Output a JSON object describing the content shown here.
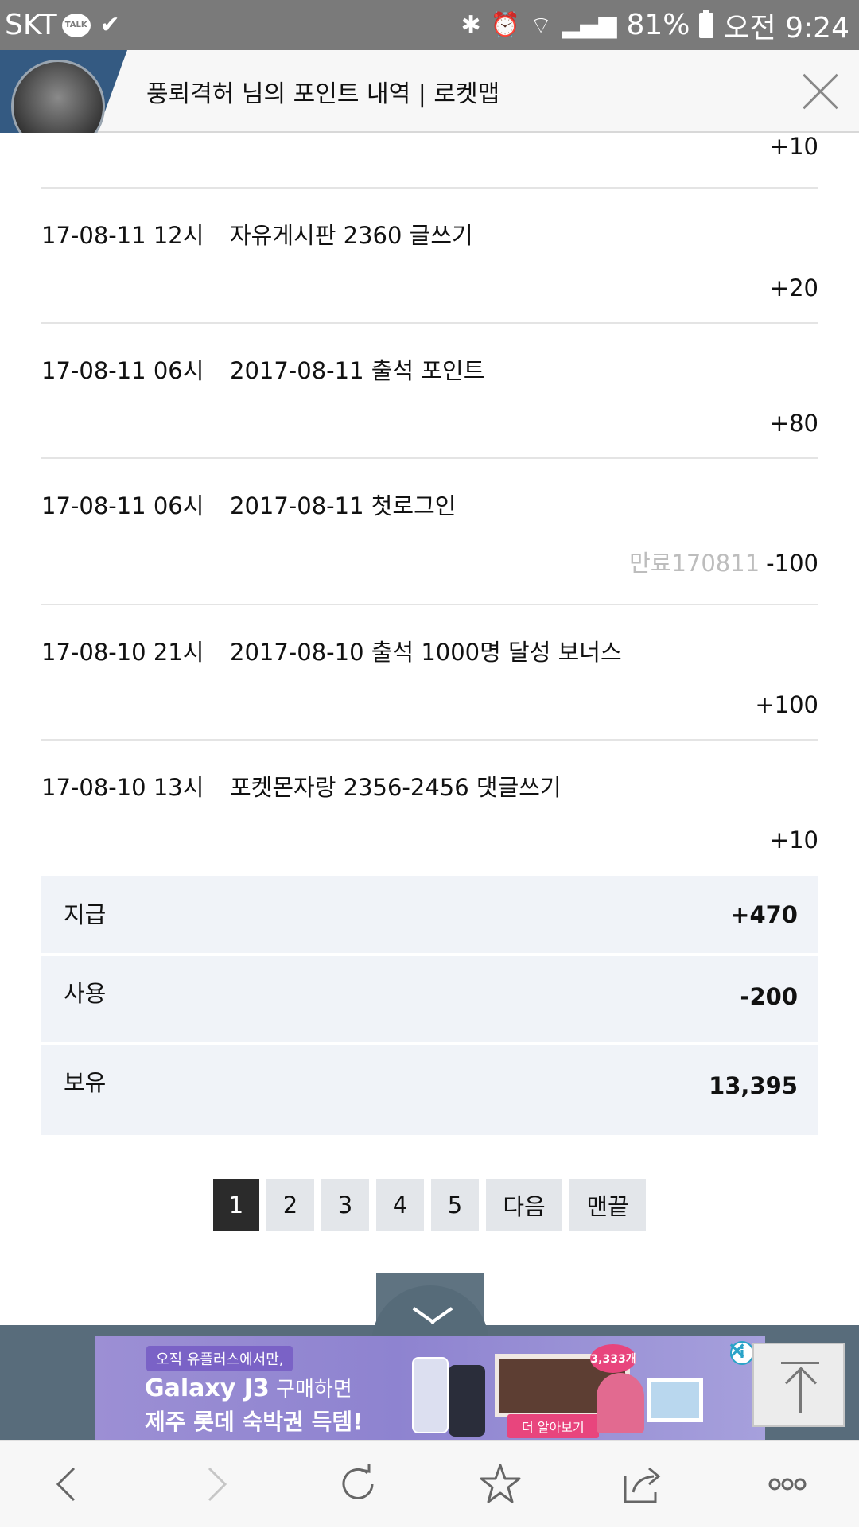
{
  "status_bar": {
    "carrier": "SKT",
    "talk_badge": "TALK",
    "battery": "81%",
    "time": "오전 9:24"
  },
  "title_bar": {
    "title": "풍뢰격허 님의 포인트 내역 | 로켓맵"
  },
  "history": {
    "top_partial_points": "+10",
    "rows": [
      {
        "date": "17-08-11 12시",
        "desc": "자유게시판 2360 글쓰기",
        "expiry": "",
        "points": "+20"
      },
      {
        "date": "17-08-11 06시",
        "desc": "2017-08-11 출석 포인트",
        "expiry": "",
        "points": "+80"
      },
      {
        "date": "17-08-11 06시",
        "desc": "2017-08-11 첫로그인",
        "expiry": "만료170811",
        "points": "-100"
      },
      {
        "date": "17-08-10 21시",
        "desc": "2017-08-10 출석 1000명 달성 보너스",
        "expiry": "",
        "points": "+100"
      },
      {
        "date": "17-08-10 13시",
        "desc": "포켓몬자랑 2356-2456 댓글쓰기",
        "expiry": "",
        "points": "+10"
      }
    ]
  },
  "summary": {
    "paid_label": "지급",
    "paid_value": "+470",
    "used_label": "사용",
    "used_value": "-200",
    "held_label": "보유",
    "held_value": "13,395"
  },
  "pagination": {
    "pages": [
      "1",
      "2",
      "3",
      "4",
      "5"
    ],
    "current": "1",
    "next_label": "다음",
    "last_label": "맨끝"
  },
  "ad": {
    "tag": "오직 유플러스에서만,",
    "line1_brand": "Galaxy J3",
    "line1_rest": " 구매하면",
    "line2": "제주 롯데 숙박권 득템!",
    "button": "더 알아보기",
    "badge": "3,333개",
    "info": "i",
    "close": "✕"
  },
  "colors": {
    "status_bar": "#7a7a7a",
    "summary_bg": "#f0f3f8",
    "active_page": "#2b2b2b",
    "page_btn": "#e3e6ea",
    "ad_strip": "#586c7b",
    "expiry_text": "#bdbdbd"
  },
  "icons": [
    "talk-icon",
    "check-icon",
    "bluetooth-icon",
    "alarm-icon",
    "wifi-icon",
    "signal-icon",
    "battery-icon",
    "close-icon",
    "chevron-down-icon",
    "scroll-top-icon",
    "back-icon",
    "forward-icon",
    "reload-icon",
    "bookmark-star-icon",
    "share-icon",
    "more-icon"
  ]
}
